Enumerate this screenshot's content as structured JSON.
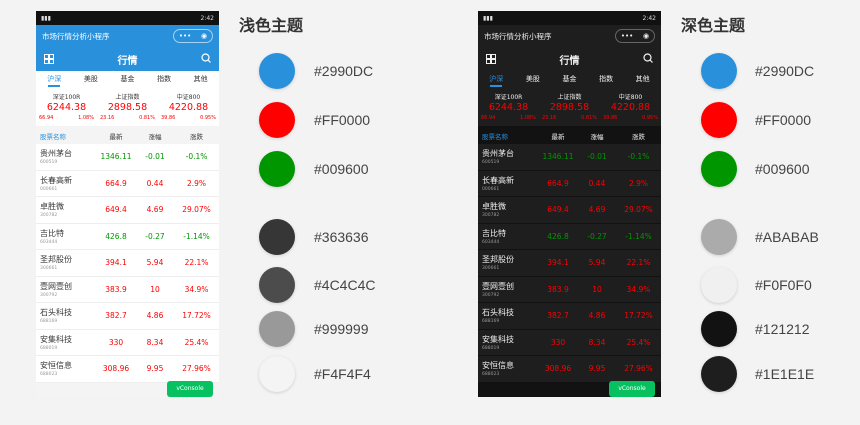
{
  "themes": [
    {
      "title": "浅色主题",
      "phone": {
        "status_time": "2:42",
        "mini_title": "市场行情分析小程序",
        "capsule_more": "•••",
        "capsule_close": "◉",
        "page_title": "行情",
        "tabs": [
          "沪深",
          "美股",
          "基金",
          "指数",
          "其他"
        ],
        "indices": [
          {
            "name": "深证100R",
            "value": "6244.38",
            "chg": "66.94",
            "pct": "1.08%"
          },
          {
            "name": "上证指数",
            "value": "2898.58",
            "chg": "23.16",
            "pct": "0.81%"
          },
          {
            "name": "中证800",
            "value": "4220.88",
            "chg": "39.86",
            "pct": "0.95%"
          }
        ],
        "header": {
          "name": "股票名称",
          "latest": "最新",
          "change": "涨幅",
          "pct": "涨跌"
        },
        "vconsole": "vConsole"
      },
      "swatches": [
        {
          "hex": "#2990DC",
          "label": "#2990DC"
        },
        {
          "hex": "#FF0000",
          "label": "#FF0000"
        },
        {
          "hex": "#009600",
          "label": "#009600"
        },
        {
          "hex": "#363636",
          "label": "#363636"
        },
        {
          "hex": "#4C4C4C",
          "label": "#4C4C4C"
        },
        {
          "hex": "#999999",
          "label": "#999999"
        },
        {
          "hex": "#F4F4F4",
          "label": "#F4F4F4"
        }
      ]
    },
    {
      "title": "深色主题",
      "phone": {
        "status_time": "2:42",
        "mini_title": "市场行情分析小程序",
        "capsule_more": "•••",
        "capsule_close": "◉",
        "page_title": "行情",
        "tabs": [
          "沪深",
          "美股",
          "基金",
          "指数",
          "其他"
        ],
        "indices": [
          {
            "name": "深证100R",
            "value": "6244.38",
            "chg": "66.94",
            "pct": "1.08%"
          },
          {
            "name": "上证指数",
            "value": "2898.58",
            "chg": "23.16",
            "pct": "0.81%"
          },
          {
            "name": "中证800",
            "value": "4220.88",
            "chg": "39.86",
            "pct": "0.95%"
          }
        ],
        "header": {
          "name": "股票名称",
          "latest": "最新",
          "change": "涨幅",
          "pct": "涨跌"
        },
        "vconsole": "vConsole"
      },
      "swatches": [
        {
          "hex": "#2990DC",
          "label": "#2990DC"
        },
        {
          "hex": "#FF0000",
          "label": "#FF0000"
        },
        {
          "hex": "#009600",
          "label": "#009600"
        },
        {
          "hex": "#ABABAB",
          "label": "#ABABAB"
        },
        {
          "hex": "#F0F0F0",
          "label": "#F0F0F0"
        },
        {
          "hex": "#121212",
          "label": "#121212"
        },
        {
          "hex": "#1E1E1E",
          "label": "#1E1E1E"
        }
      ]
    }
  ],
  "stocks": [
    {
      "name": "贵州茅台",
      "code": "600519",
      "price": "1346.11",
      "change": "-0.01",
      "pct": "-0.1%",
      "dir": "down"
    },
    {
      "name": "长春高新",
      "code": "000661",
      "price": "664.9",
      "change": "0.44",
      "pct": "2.9%",
      "dir": "up"
    },
    {
      "name": "卓胜微",
      "code": "300782",
      "price": "649.4",
      "change": "4.69",
      "pct": "29.07%",
      "dir": "up"
    },
    {
      "name": "吉比特",
      "code": "603444",
      "price": "426.8",
      "change": "-0.27",
      "pct": "-1.14%",
      "dir": "down"
    },
    {
      "name": "圣邦股份",
      "code": "300661",
      "price": "394.1",
      "change": "5.94",
      "pct": "22.1%",
      "dir": "up"
    },
    {
      "name": "壹网壹创",
      "code": "300792",
      "price": "383.9",
      "change": "10",
      "pct": "34.9%",
      "dir": "up"
    },
    {
      "name": "石头科技",
      "code": "688169",
      "price": "382.7",
      "change": "4.86",
      "pct": "17.72%",
      "dir": "up"
    },
    {
      "name": "安集科技",
      "code": "688019",
      "price": "330",
      "change": "8.34",
      "pct": "25.4%",
      "dir": "up"
    },
    {
      "name": "安恒信息",
      "code": "688023",
      "price": "308.96",
      "change": "9.95",
      "pct": "27.96%",
      "dir": "up"
    }
  ]
}
